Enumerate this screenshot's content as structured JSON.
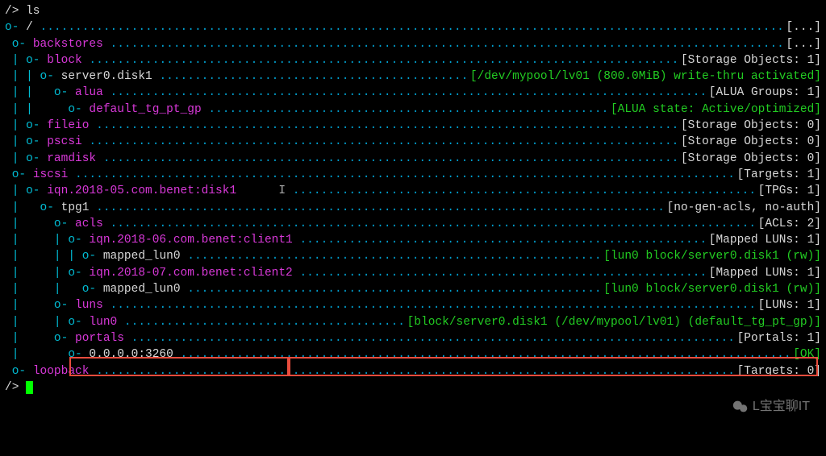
{
  "prompt1": "/> ls",
  "prompt2": "/> ",
  "root": {
    "prefix": "o- ",
    "name": "/",
    "status": "[...]"
  },
  "backstores": {
    "prefix": " o- ",
    "name": "backstores",
    "status": "[...]"
  },
  "block": {
    "prefix": " | o- ",
    "name": "block",
    "status_label": "[Storage Objects: 1]"
  },
  "server0": {
    "prefix": " | | o- ",
    "name": "server0.disk1",
    "detail": "[/dev/mypool/lv01 (800.0MiB) write-thru activated]"
  },
  "alua": {
    "prefix": " | |   o- ",
    "name": "alua",
    "status": "[ALUA Groups: 1]"
  },
  "default_tg": {
    "prefix": " | |     o- ",
    "name": "default_tg_pt_gp",
    "status": "[ALUA state: Active/optimized]"
  },
  "fileio": {
    "prefix": " | o- ",
    "name": "fileio",
    "status": "[Storage Objects: 0]"
  },
  "pscsi": {
    "prefix": " | o- ",
    "name": "pscsi",
    "status": "[Storage Objects: 0]"
  },
  "ramdisk": {
    "prefix": " | o- ",
    "name": "ramdisk",
    "status": "[Storage Objects: 0]"
  },
  "iscsi": {
    "prefix": " o- ",
    "name": "iscsi",
    "status": "[Targets: 1]"
  },
  "iqn_disk1": {
    "prefix": " | o- ",
    "name": "iqn.2018-05.com.benet:disk1",
    "status": "[TPGs: 1]"
  },
  "tpg1": {
    "prefix": " |   o- ",
    "name": "tpg1",
    "status": "[no-gen-acls, no-auth]"
  },
  "acls": {
    "prefix": " |     o- ",
    "name": "acls",
    "status": "[ACLs: 2]"
  },
  "client1": {
    "prefix": " |     | o- ",
    "name": "iqn.2018-06.com.benet:client1",
    "status": "[Mapped LUNs: 1]"
  },
  "mapped1": {
    "prefix": " |     | | o- ",
    "name": "mapped_lun0",
    "detail": "[lun0 block/server0.disk1 (rw)]"
  },
  "client2": {
    "prefix": " |     | o- ",
    "name": "iqn.2018-07.com.benet:client2",
    "status": "[Mapped LUNs: 1]"
  },
  "mapped2": {
    "prefix": " |     |   o- ",
    "name": "mapped_lun0",
    "detail": "[lun0 block/server0.disk1 (rw)]"
  },
  "luns": {
    "prefix": " |     o- ",
    "name": "luns",
    "status": "[LUNs: 1]"
  },
  "lun0": {
    "prefix": " |     | o- ",
    "name": "lun0",
    "detail": "[block/server0.disk1 (/dev/mypool/lv01) (default_tg_pt_gp)]"
  },
  "portals": {
    "prefix": " |     o- ",
    "name": "portals",
    "status": "[Portals: 1]"
  },
  "portal0": {
    "prefix": " |       o- ",
    "name": "0.0.0.0:3260",
    "status": "[OK]"
  },
  "loopback": {
    "prefix": " o- ",
    "name": "loopback",
    "status": "[Targets: 0]"
  },
  "watermark": "L宝宝聊IT"
}
